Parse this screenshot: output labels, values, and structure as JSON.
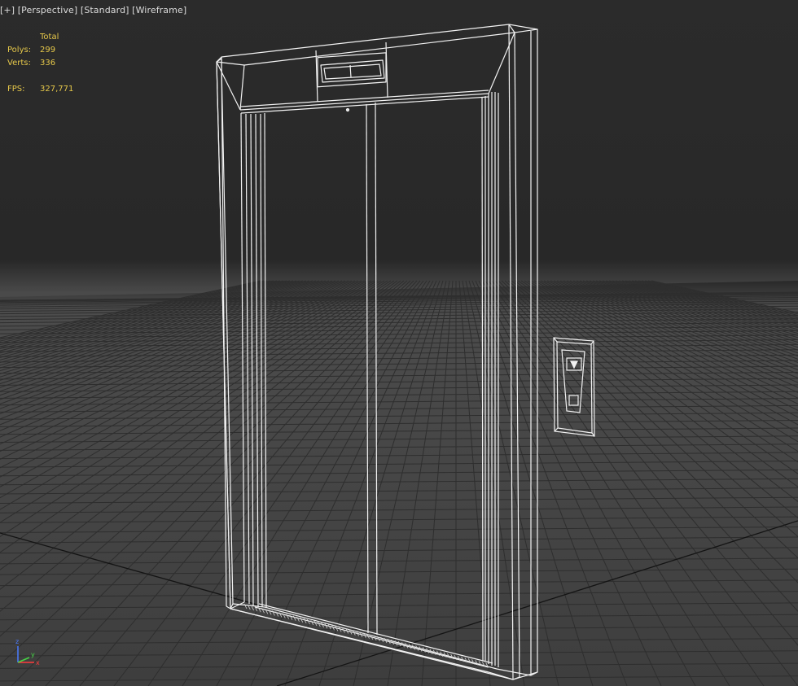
{
  "viewport": {
    "labels": [
      "[+]",
      "[Perspective]",
      "[Standard]",
      "[Wireframe]"
    ]
  },
  "stats": {
    "header": "Total",
    "polys_label": "Polys:",
    "polys": "299",
    "verts_label": "Verts:",
    "verts": "336",
    "fps_label": "FPS:",
    "fps": "327,771"
  },
  "gizmo": {
    "z": "z",
    "x": "x",
    "y": "y"
  },
  "colors": {
    "stats_text": "#e6c84a",
    "wire": "#ffffff",
    "x_axis": "#ff3b3b",
    "y_axis": "#45d545",
    "z_axis": "#4a7bff"
  }
}
